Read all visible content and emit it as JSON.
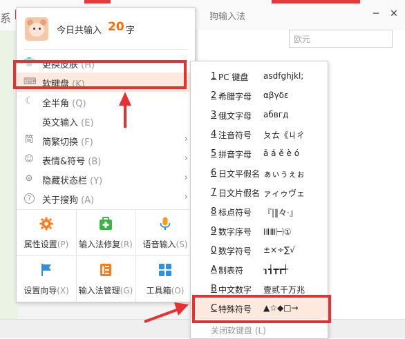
{
  "background": {
    "title": "狗输入法",
    "left_fragment": "系",
    "search_placeholder": "欧元",
    "minimize_glyph": "─",
    "close_glyph": "✕"
  },
  "header": {
    "prefix": "今日共输入",
    "count": "20",
    "unit": "字"
  },
  "menu": {
    "items": [
      {
        "icon": "skin-icon",
        "glyph": "👕",
        "label": "更换皮肤",
        "shortcut": "(H)",
        "arrow": "›"
      },
      {
        "icon": "keyboard-icon",
        "glyph": "⌨",
        "label": "软键盘",
        "shortcut": "(K)",
        "arrow": "›"
      },
      {
        "icon": "moon-icon",
        "glyph": "☾",
        "label": "全半角",
        "shortcut": "(Q)",
        "arrow": ""
      },
      {
        "icon": "english-icon",
        "glyph": "",
        "label": "英文输入",
        "shortcut": "(E)",
        "arrow": ""
      },
      {
        "icon": "simplified-traditional-icon",
        "glyph": "简",
        "label": "简繁切换",
        "shortcut": "(F)",
        "arrow": "›"
      },
      {
        "icon": "emoji-icon",
        "glyph": "☺",
        "label": "表情&符号",
        "shortcut": "(B)",
        "arrow": "›"
      },
      {
        "icon": "hide-statusbar-icon",
        "glyph": "⊜",
        "label": "隐藏状态栏",
        "shortcut": "(Y)",
        "arrow": "›"
      },
      {
        "icon": "about-icon",
        "glyph": "?",
        "label": "关于搜狗",
        "shortcut": "(A)",
        "arrow": "›"
      }
    ],
    "grid": [
      {
        "icon": "settings-gear-icon",
        "label": "属性设置",
        "shortcut": "(P)"
      },
      {
        "icon": "repair-kit-icon",
        "label": "输入法修复",
        "shortcut": "(R)"
      },
      {
        "icon": "microphone-icon",
        "label": "语音输入",
        "shortcut": "(S)"
      },
      {
        "icon": "flag-icon",
        "label": "设置向导",
        "shortcut": "(X)"
      },
      {
        "icon": "manager-icon",
        "label": "输入法管理",
        "shortcut": "(G)"
      },
      {
        "icon": "toolbox-icon",
        "label": "工具箱",
        "shortcut": "(O)"
      }
    ]
  },
  "submenu": {
    "items": [
      {
        "num": "1",
        "name": "PC 键盘",
        "sample": "asdfghjkl;"
      },
      {
        "num": "2",
        "name": "希腊字母",
        "sample": "αβγδε"
      },
      {
        "num": "3",
        "name": "俄文字母",
        "sample": "абвгд"
      },
      {
        "num": "4",
        "name": "注音符号",
        "sample": "ㄆㄊ《ㄐㄔ"
      },
      {
        "num": "5",
        "name": "拼音字母",
        "sample": "ā á ě è ó"
      },
      {
        "num": "6",
        "name": "日文平假名",
        "sample": "ぁぃぅぇぉ"
      },
      {
        "num": "7",
        "name": "日文片假名",
        "sample": "ァィゥヴェ"
      },
      {
        "num": "8",
        "name": "标点符号",
        "sample": "『|‖々·』"
      },
      {
        "num": "9",
        "name": "数字序号",
        "sample": "ⅠⅡⅢ㈠①"
      },
      {
        "num": "0",
        "name": "数学符号",
        "sample": "±×÷∑√"
      },
      {
        "num": "A",
        "name": "制表符",
        "sample": "┒┪┳┲┽"
      },
      {
        "num": "B",
        "name": "中文数字",
        "sample": "壹贰千万兆"
      },
      {
        "num": "C",
        "name": "特殊符号",
        "sample": "▲☆◆□→"
      }
    ],
    "close_label": "关闭软键盘",
    "close_shortcut": "(L)"
  },
  "colors": {
    "accent": "#ff6a00",
    "highlight_bg": "#fde9dd",
    "annotation_red": "#e83030"
  }
}
